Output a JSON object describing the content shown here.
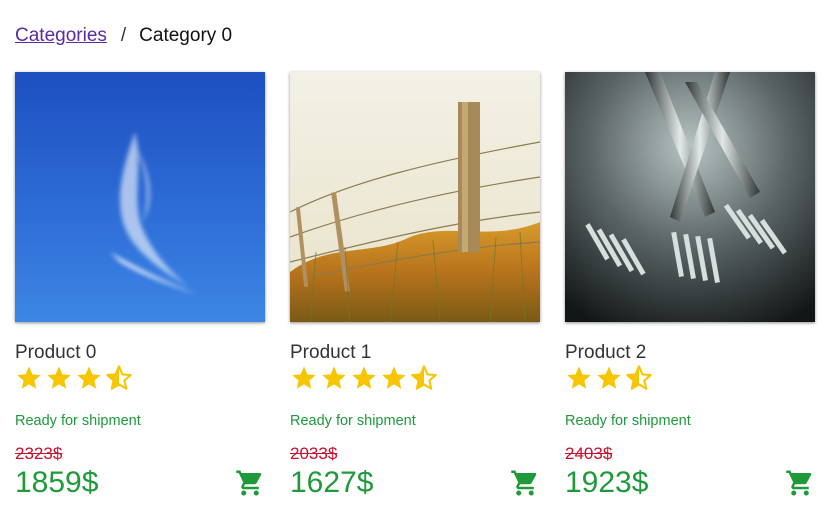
{
  "breadcrumb": {
    "root": "Categories",
    "separator": "/",
    "current": "Category 0"
  },
  "colors": {
    "star": "#f7c600",
    "stock": "#1e9a3a",
    "old_price": "#c8102e",
    "price": "#1e9a3a",
    "link": "#5b2ca0"
  },
  "products": [
    {
      "name": "Product 0",
      "rating": 3.5,
      "stock": "Ready for shipment",
      "old_price": "2323$",
      "price": "1859$",
      "image": "blue sky with white wispy cloud",
      "cart_icon": "cart-icon"
    },
    {
      "name": "Product 1",
      "rating": 4.5,
      "stock": "Ready for shipment",
      "old_price": "2033$",
      "price": "1627$",
      "image": "barbed wire fence post in dry grass",
      "cart_icon": "cart-icon"
    },
    {
      "name": "Product 2",
      "rating": 2.5,
      "stock": "Ready for shipment",
      "old_price": "2403$",
      "price": "1923$",
      "image": "silver forks on dark background",
      "cart_icon": "cart-icon"
    }
  ]
}
